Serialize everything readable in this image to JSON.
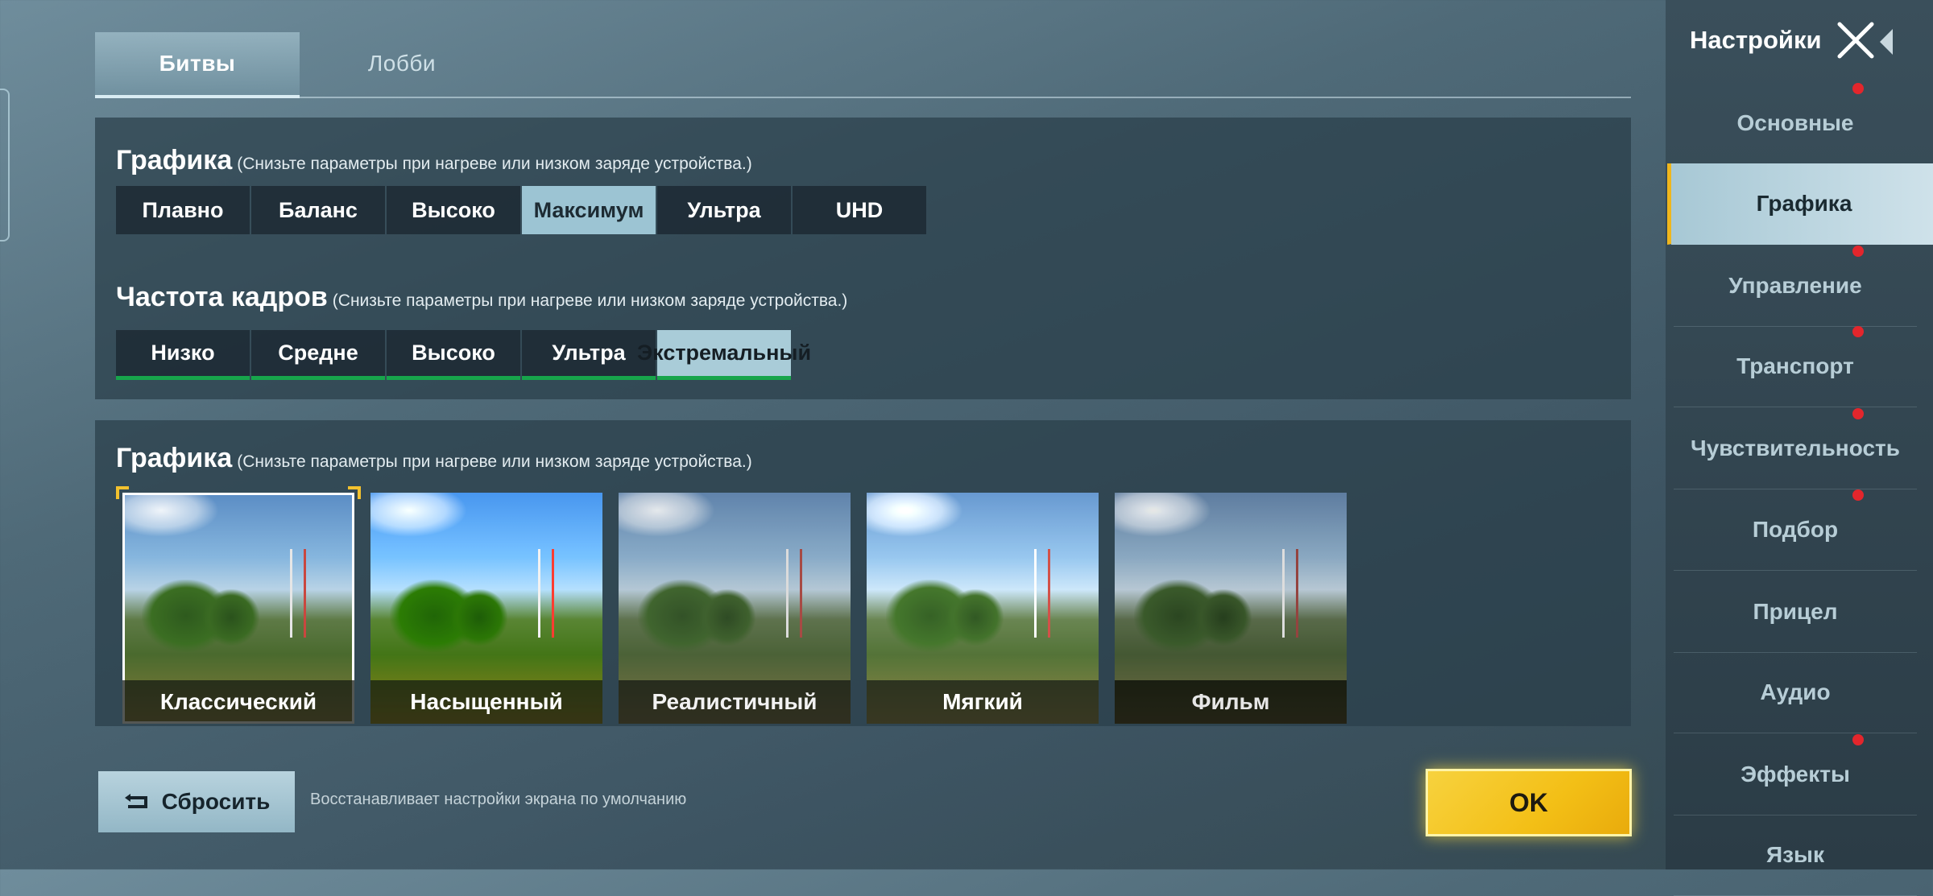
{
  "top_tabs": [
    {
      "label": "Битвы",
      "active": true
    },
    {
      "label": "Лобби",
      "active": false
    }
  ],
  "graphics_quality": {
    "title": "Графика",
    "hint": "(Снизьте параметры при нагреве или низком заряде устройства.)",
    "options": [
      "Плавно",
      "Баланс",
      "Высоко",
      "Максимум",
      "Ультра",
      "UHD"
    ],
    "selected": "Максимум"
  },
  "frame_rate": {
    "title": "Частота кадров",
    "hint": "(Снизьте параметры при нагреве или низком заряде устройства.)",
    "options": [
      "Низко",
      "Средне",
      "Высоко",
      "Ультра",
      "Экстремальный"
    ],
    "selected": "Экстремальный"
  },
  "graphics_style": {
    "title": "Графика",
    "hint": "(Снизьте параметры при нагреве или низком заряде устройства.)",
    "options": [
      "Классический",
      "Насыщенный",
      "Реалистичный",
      "Мягкий",
      "Фильм"
    ],
    "selected": "Классический"
  },
  "footer": {
    "reset_label": "Сбросить",
    "reset_hint": "Восстанавливает настройки экрана по умолчанию",
    "ok_label": "OK"
  },
  "sidebar": {
    "title": "Настройки",
    "items": [
      {
        "label": "Основные",
        "active": false,
        "notification": true
      },
      {
        "label": "Графика",
        "active": true,
        "notification": false
      },
      {
        "label": "Управление",
        "active": false,
        "notification": true
      },
      {
        "label": "Транспорт",
        "active": false,
        "notification": true
      },
      {
        "label": "Чувствительность",
        "active": false,
        "notification": true
      },
      {
        "label": "Подбор",
        "active": false,
        "notification": true
      },
      {
        "label": "Прицел",
        "active": false,
        "notification": false
      },
      {
        "label": "Аудио",
        "active": false,
        "notification": false
      },
      {
        "label": "Эффекты",
        "active": false,
        "notification": true
      },
      {
        "label": "Язык",
        "active": false,
        "notification": false
      }
    ]
  },
  "colors": {
    "accent_yellow": "#f3bf16",
    "selected_blue": "#9cc4d3",
    "fps_green": "#17a54b",
    "notification_red": "#e3262c"
  }
}
